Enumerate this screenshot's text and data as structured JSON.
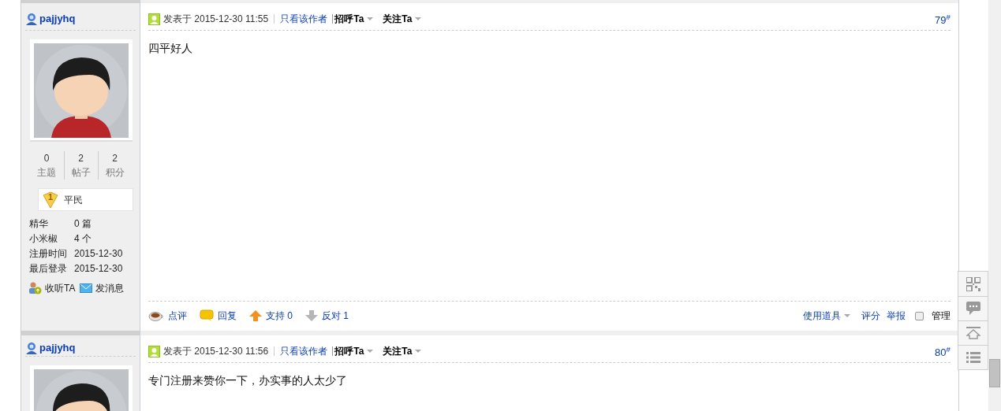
{
  "posts": [
    {
      "author": "pajjyhq",
      "stats": [
        {
          "value": "0",
          "label": "主题"
        },
        {
          "value": "2",
          "label": "帖子"
        },
        {
          "value": "2",
          "label": "积分"
        }
      ],
      "rank": {
        "level": "1",
        "title": "平民"
      },
      "profile": [
        {
          "label": "精华",
          "value": "0 篇"
        },
        {
          "label": "小米椒",
          "value": "4 个"
        },
        {
          "label": "注册时间",
          "value": "2015-12-30"
        },
        {
          "label": "最后登录",
          "value": "2015-12-30"
        }
      ],
      "user_actions": [
        {
          "kind": "follow",
          "label": "收听TA"
        },
        {
          "kind": "message",
          "label": "发消息"
        }
      ],
      "posted": "发表于 2015-12-30 11:55",
      "author_only": "只看该作者",
      "greet": "招呼Ta",
      "watch": "关注Ta",
      "floor": "79$^{#}$",
      "content": "四平好人",
      "actions": [
        {
          "kind": "comment",
          "label": "点评"
        },
        {
          "kind": "reply",
          "label": "回复"
        },
        {
          "kind": "support",
          "label": "支持 0"
        },
        {
          "kind": "oppose",
          "label": "反对 1"
        }
      ],
      "tools": "使用道具",
      "rate": "评分",
      "report": "举报",
      "manage": {
        "label": "管理",
        "checked": false
      }
    },
    {
      "author": "pajjyhq",
      "posted": "发表于 2015-12-30 11:56",
      "author_only": "只看该作者",
      "greet": "招呼Ta",
      "watch": "关注Ta",
      "floor": "80$^{#}$",
      "content": "专门注册来赞你一下，办实事的人太少了"
    }
  ],
  "side_tools": [
    {
      "kind": "qrcode"
    },
    {
      "kind": "feedback"
    },
    {
      "kind": "top"
    },
    {
      "kind": "list"
    }
  ]
}
